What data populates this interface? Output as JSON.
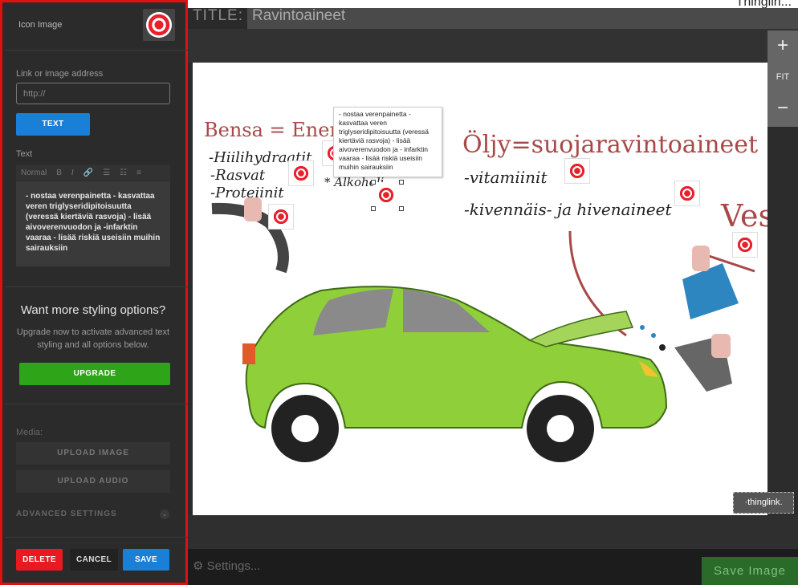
{
  "top_right_text": "Thinglin...",
  "title_label": "TITLE:",
  "title_value": "Ravintoaineet",
  "zoom": {
    "plus": "+",
    "fit": "FIT",
    "minus": "−"
  },
  "sidebar": {
    "icon_image_label": "Icon Image",
    "link_label": "Link or image address",
    "link_placeholder": "http://",
    "text_button": "TEXT",
    "text_label": "Text",
    "toolbar": {
      "format": "Normal",
      "bold": "B",
      "italic": "I",
      "link": "🔗",
      "ol": "☰",
      "ul": "☷",
      "align": "≡"
    },
    "text_value": "- nostaa verenpainetta - kasvattaa veren triglyseridipitoisuutta (veressä kiertäviä rasvoja) - lisää aivoverenvuodon ja -infarktin vaaraa - lisää riskiä useisiin muihin sairauksiin",
    "upgrade_title": "Want more styling options?",
    "upgrade_text": "Upgrade now to activate advanced text styling and all options below.",
    "upgrade_button": "UPGRADE",
    "media_label": "Media:",
    "upload_image": "UPLOAD IMAGE",
    "upload_audio": "UPLOAD AUDIO",
    "advanced": "ADVANCED SETTINGS",
    "delete": "DELETE",
    "cancel": "CANCEL",
    "save": "SAVE"
  },
  "tooltip": "- nostaa verenpainetta - kasvattaa veren triglyseridipitoisuutta (veressä kiertäviä rasvoja) - lisää aivoverenvuodon ja - infarktin vaaraa - lisää riskiä useisiin muihin sairauksiin",
  "canvas_text": {
    "bensa": "Bensa = Energiaravi",
    "hiilihydraatit": "-Hiilihydraatit",
    "rasvat": "-Rasvat",
    "proteiinit": "-Proteiinit",
    "alkoholi": "* Alkoholi",
    "oljy": "Öljy=suojaravintoaineet",
    "vitamiinit": "-vitamiinit",
    "kivennais": "-kivennäis- ja hivenaineet",
    "vesi": "Vesi"
  },
  "settings_label": "Settings...",
  "save_image": "Save Image",
  "thinglink": "·thinglink.",
  "colors": {
    "accent_blue": "#1a7fd6",
    "upgrade_green": "#2ea418",
    "delete_red": "#e8191f",
    "sidebar_border": "#e01010"
  }
}
